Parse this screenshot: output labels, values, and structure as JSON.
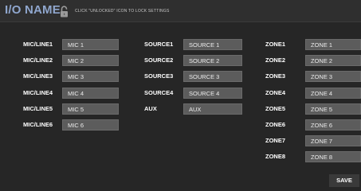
{
  "header": {
    "title": "I/O NAME",
    "hint": "CLICK \"UNLOCKED\" ICON TO LOCK SETTINGS",
    "lock_icon": "unlocked-padlock-icon",
    "title_color": "#8fa6cd"
  },
  "mics": [
    {
      "label": "MIC/LINE1",
      "value": "MIC 1"
    },
    {
      "label": "MIC/LINE2",
      "value": "MIC 2"
    },
    {
      "label": "MIC/LINE3",
      "value": "MIC 3"
    },
    {
      "label": "MIC/LINE4",
      "value": "MIC 4"
    },
    {
      "label": "MIC/LINE5",
      "value": "MIC 5"
    },
    {
      "label": "MIC/LINE6",
      "value": "MIC 6"
    }
  ],
  "sources": [
    {
      "label": "SOURCE1",
      "value": "SOURCE 1"
    },
    {
      "label": "SOURCE2",
      "value": "SOURCE 2"
    },
    {
      "label": "SOURCE3",
      "value": "SOURCE 3"
    },
    {
      "label": "SOURCE4",
      "value": "SOURCE 4"
    },
    {
      "label": "AUX",
      "value": "AUX"
    }
  ],
  "zones": [
    {
      "label": "ZONE1",
      "value": "ZONE 1"
    },
    {
      "label": "ZONE2",
      "value": "ZONE 2"
    },
    {
      "label": "ZONE3",
      "value": "ZONE 3"
    },
    {
      "label": "ZONE4",
      "value": "ZONE 4"
    },
    {
      "label": "ZONE5",
      "value": "ZONE 5"
    },
    {
      "label": "ZONE6",
      "value": "ZONE 6"
    },
    {
      "label": "ZONE7",
      "value": "ZONE 7"
    },
    {
      "label": "ZONE8",
      "value": "ZONE 8"
    }
  ],
  "save_label": "SAVE"
}
